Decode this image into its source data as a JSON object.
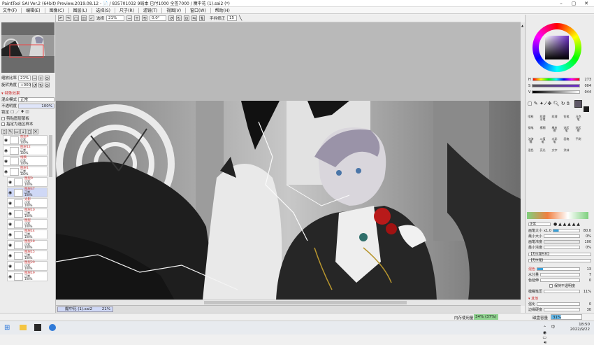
{
  "window": {
    "title": "PaintTool SAI Ver.2 (64bit) Preview.2019.08.12 - 📄 / 835701032 9局本 已付1000 全签7000 / 魔中花 (1).sai2 (*)"
  },
  "menu": [
    "文件(F)",
    "编辑(E)",
    "图像(C)",
    "图层(L)",
    "选择(S)",
    "尺子(R)",
    "滤镜(T)",
    "视图(V)",
    "窗口(W)",
    "帮助(H)"
  ],
  "toolbar": {
    "select_label": "选择",
    "zoom": "21%",
    "rotation": "0.0°",
    "stabilizer_label": "手抖修正",
    "stabilizer_value": "15"
  },
  "left_panel": {
    "zoom_label": "缩放比率",
    "zoom_value": "21%",
    "angle_label": "旋转角度",
    "angle_value": "+000",
    "section_title": "▾ 特殊效果",
    "blend_label": "混合模式",
    "blend_value": "正常",
    "opacity_label": "不透明度",
    "opacity_value": "100%",
    "lock_label": "锁定",
    "checkbox1": "剪贴图层蒙板",
    "checkbox2": "指定为选区样本",
    "layers": [
      {
        "name": "图层4",
        "mode": "正常",
        "opacity": "100%"
      },
      {
        "name": "图层12",
        "mode": "正常",
        "opacity": "100%"
      },
      {
        "name": "线稿",
        "mode": "正常",
        "opacity": "100%"
      },
      {
        "name": "图层1",
        "mode": "正常",
        "opacity": "100%"
      },
      {
        "name": "图层9",
        "mode": "正常",
        "opacity": "100%"
      },
      {
        "name": "图层47",
        "mode": "正常",
        "opacity": "100%"
      },
      {
        "name": "光影",
        "mode": "正常",
        "opacity": "100%"
      },
      {
        "name": "图层10",
        "mode": "正常",
        "opacity": "100%"
      },
      {
        "name": "图层",
        "mode": "正常",
        "opacity": "100%"
      },
      {
        "name": "图层14",
        "mode": "正常",
        "opacity": "100%"
      },
      {
        "name": "图层18",
        "mode": "正常",
        "opacity": "100%"
      },
      {
        "name": "图层15",
        "mode": "正常",
        "opacity": "100%"
      },
      {
        "name": "图层20",
        "mode": "正常",
        "opacity": "100%"
      },
      {
        "name": "图层19",
        "mode": "正常",
        "opacity": "100%"
      }
    ]
  },
  "doc_tab": {
    "name": "魔中花 (1).sai2",
    "zoom": "21%"
  },
  "status": {
    "memory_label": "内存使用量",
    "memory_value": "34% (37%)",
    "disk_label": "磁盘容量",
    "disk_value": "31%"
  },
  "right_panel": {
    "h_label": "H",
    "h_value": "273",
    "s_label": "S",
    "s_value": "004",
    "v_label": "V",
    "v_value": "044",
    "blend_value": "正常",
    "brush_size_label": "画笔大小",
    "brush_size_mult": "x1.0",
    "brush_size_value": "80.0",
    "min_size_label": "最小大小",
    "min_size_value": "0%",
    "density_label": "画笔浓度",
    "density_value": "100",
    "min_density_label": "最小浓度",
    "min_density_value": "0%",
    "shape_label": "【无纹理形状】",
    "texture_label": "【无纹理】",
    "mix_label": "混色",
    "mix_value": "13",
    "water_label": "水分量",
    "water_value": "7",
    "keep_label": "色延伸",
    "keep_value": "0",
    "keep_opacity_label": "保持不透明度",
    "blur_label": "模糊笔压",
    "blur_value": "11%",
    "other_label": "▾ 其他",
    "quality_label": "强化",
    "quality_value": "0",
    "edge_label": "边缘硬度",
    "edge_value": "30",
    "brush_names": [
      "喷枪",
      "纹理水笔",
      "纹理",
      "铅笔",
      "马克笔",
      "钢笔",
      "模糊",
      "橡皮擦",
      "选区笔",
      "选区擦",
      "油漆桶",
      "二值笔",
      "水彩笔",
      "画笔",
      "平刷",
      "混色",
      "亮光",
      "文字",
      "涂抹"
    ]
  },
  "taskbar": {
    "time": "18:50",
    "date": "2022/9/22",
    "lang": "中"
  },
  "colors": {
    "accent_blue": "#cfd8f6",
    "current_color": "#5e5866",
    "brush_blue": "#39a0d8"
  }
}
